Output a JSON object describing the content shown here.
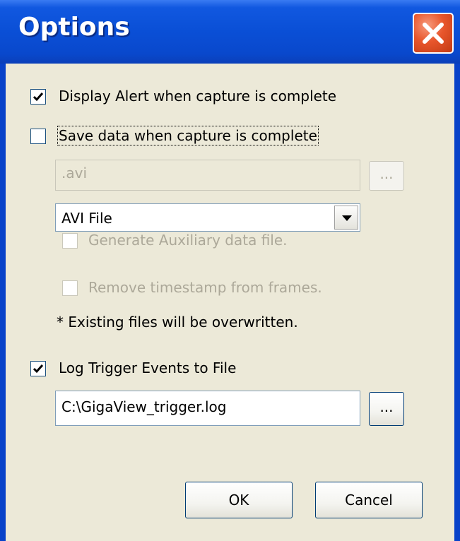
{
  "window": {
    "title": "Options"
  },
  "options": {
    "display_alert": {
      "label": "Display Alert when capture is complete",
      "checked": true
    },
    "save_data": {
      "label": "Save data when capture is complete",
      "checked": false
    },
    "save_path": {
      "value": ".avi"
    },
    "browse_save_label": "...",
    "file_type": {
      "selected": "AVI File"
    },
    "generate_aux": {
      "label": "Generate Auxiliary data file.",
      "checked": false
    },
    "remove_timestamp": {
      "label": "Remove timestamp from frames.",
      "checked": false
    },
    "overwrite_note": "* Existing files will be overwritten.",
    "log_trigger": {
      "label": "Log Trigger Events to File",
      "checked": true
    },
    "log_path": {
      "value": "C:\\GigaView_trigger.log"
    },
    "browse_log_label": "..."
  },
  "buttons": {
    "ok": "OK",
    "cancel": "Cancel"
  },
  "colors": {
    "titlebar": "#0a4fd6",
    "client": "#ece9d8",
    "close": "#e8562c"
  }
}
